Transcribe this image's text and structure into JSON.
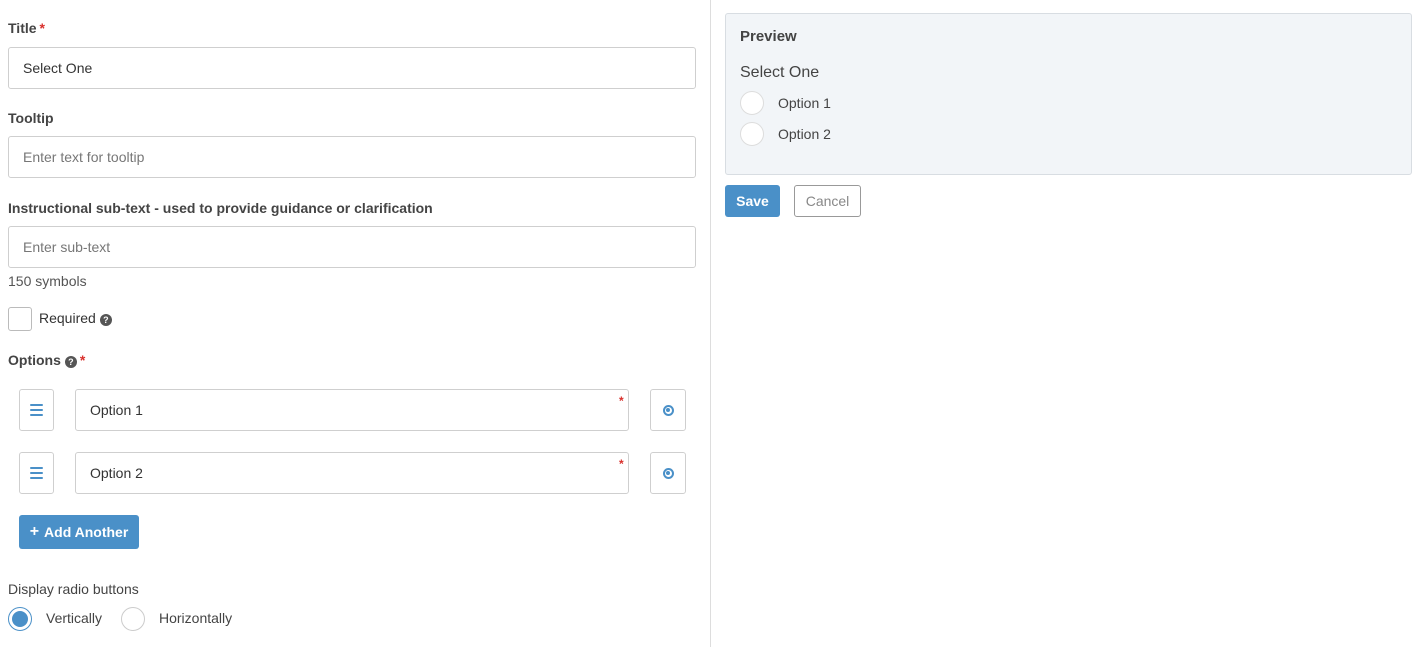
{
  "form": {
    "title_label": "Title",
    "required_mark": "*",
    "title_value": "Select One",
    "tooltip_label": "Tooltip",
    "tooltip_placeholder": "Enter text for tooltip",
    "subtext_label": "Instructional sub-text - used to provide guidance or clarification",
    "subtext_placeholder": "Enter sub-text",
    "subtext_hint": "150 symbols",
    "required_label": "Required",
    "help_glyph": "?",
    "options_label": "Options",
    "options": [
      {
        "value": "Option 1"
      },
      {
        "value": "Option 2"
      }
    ],
    "add_another_label": "Add Another",
    "add_icon": "+",
    "display_label": "Display radio buttons",
    "display_vertical": "Vertically",
    "display_horizontal": "Horizontally",
    "display_selected": "Vertically"
  },
  "preview": {
    "heading": "Preview",
    "question": "Select One",
    "options": [
      "Option 1",
      "Option 2"
    ]
  },
  "actions": {
    "save_label": "Save",
    "cancel_label": "Cancel"
  },
  "colors": {
    "accent": "#4a90c8",
    "required": "#d9302c"
  }
}
